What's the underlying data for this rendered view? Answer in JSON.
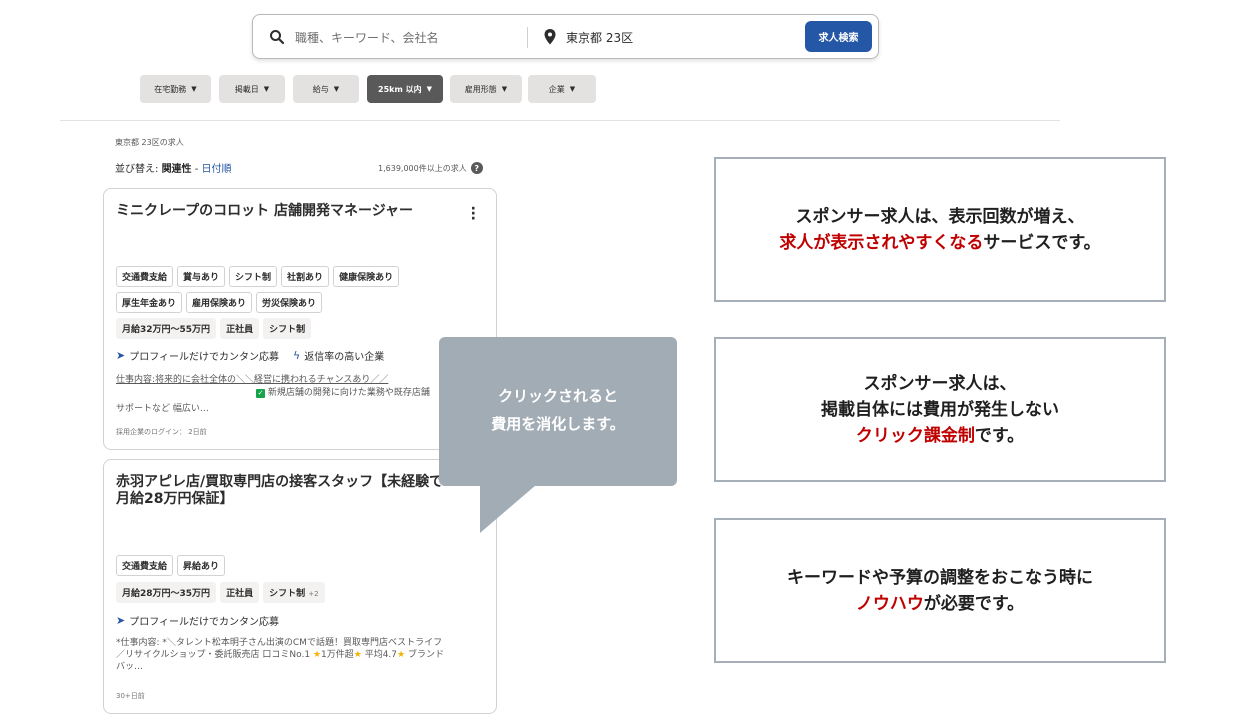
{
  "search": {
    "what_placeholder": "職種、キーワード、会社名",
    "where_value": "東京都 23区",
    "button_label": "求人検索"
  },
  "filters": [
    {
      "label": "在宅勤務",
      "active": false
    },
    {
      "label": "掲載日",
      "active": false
    },
    {
      "label": "給与",
      "active": false
    },
    {
      "label": "25km 以内",
      "active": true
    },
    {
      "label": "雇用形態",
      "active": false
    },
    {
      "label": "企業",
      "active": false
    }
  ],
  "results": {
    "location_title": "東京都 23区の求人",
    "sort_prefix": "並び替え:",
    "sort_selected": "関連性",
    "sort_separator": " - ",
    "sort_alt": "日付順",
    "count": "1,639,000件以上の求人",
    "help_icon": "?"
  },
  "jobs": [
    {
      "title": "ミニクレープのコロット 店舗開発マネージャー",
      "tags_row1": [
        "交通費支給",
        "賞与あり",
        "シフト制",
        "社割あり",
        "健康保険あり"
      ],
      "tags_row2": [
        "厚生年金あり",
        "雇用保険あり",
        "労災保険あり"
      ],
      "salary_tags": [
        "月給32万円～55万円",
        "正社員",
        "シフト制"
      ],
      "feature1": "プロフィールだけでカンタン応募",
      "feature2": "返信率の高い企業",
      "snippet_line1": "仕事内容:将来的に会社全体の＼＼経営に携われるチャンスあり／／",
      "snippet_line2": "新規店舗の開発に向けた業務や既存店舗",
      "snippet_line3": "サポートなど 幅広い…",
      "meta": "採用企業のログイン： 2日前"
    },
    {
      "title": "赤羽アピレ店/買取専門店の接客スタッフ【未経験で",
      "title_line2": "月給28万円保証】",
      "tags_row1": [
        "交通費支給",
        "昇給あり"
      ],
      "salary_tags": [
        "月給28万円～35万円",
        "正社員",
        "シフト制"
      ],
      "salary_plus": "+2",
      "feature1": "プロフィールだけでカンタン応募",
      "snippet_line1": "*仕事内容: *＼タレント松本明子さん出演のCMで話題！買取専門店ベストライフ",
      "snippet_line2a": "／リサイクルショップ・委託販売店 口コミNo.1 ",
      "snippet_line2b": "1万件超",
      "snippet_line2c": " 平均4.7",
      "snippet_line2d": " ブランド",
      "snippet_line3": "バッ…",
      "meta": "30+日前"
    }
  ],
  "bubble": {
    "line1": "クリックされると",
    "line2": "費用を消化します。",
    "color": "#a2acb5"
  },
  "info_boxes": [
    {
      "line1": "スポンサー求人は、表示回数が増え、",
      "line2_red": "求人が表示されやすくなる",
      "line2_rest": "サービスです。"
    },
    {
      "line1": "スポンサー求人は、",
      "line2": "掲載自体には費用が発生しない",
      "line3_red": "クリック課金制",
      "line3_rest": "です。"
    },
    {
      "line1": "キーワードや予算の調整をおこなう時に",
      "line2_red": "ノウハウ",
      "line2_rest": "が必要です。"
    }
  ],
  "colors": {
    "accent": "#2557a7",
    "highlight_red": "#c00000",
    "active_chip": "#595959"
  }
}
